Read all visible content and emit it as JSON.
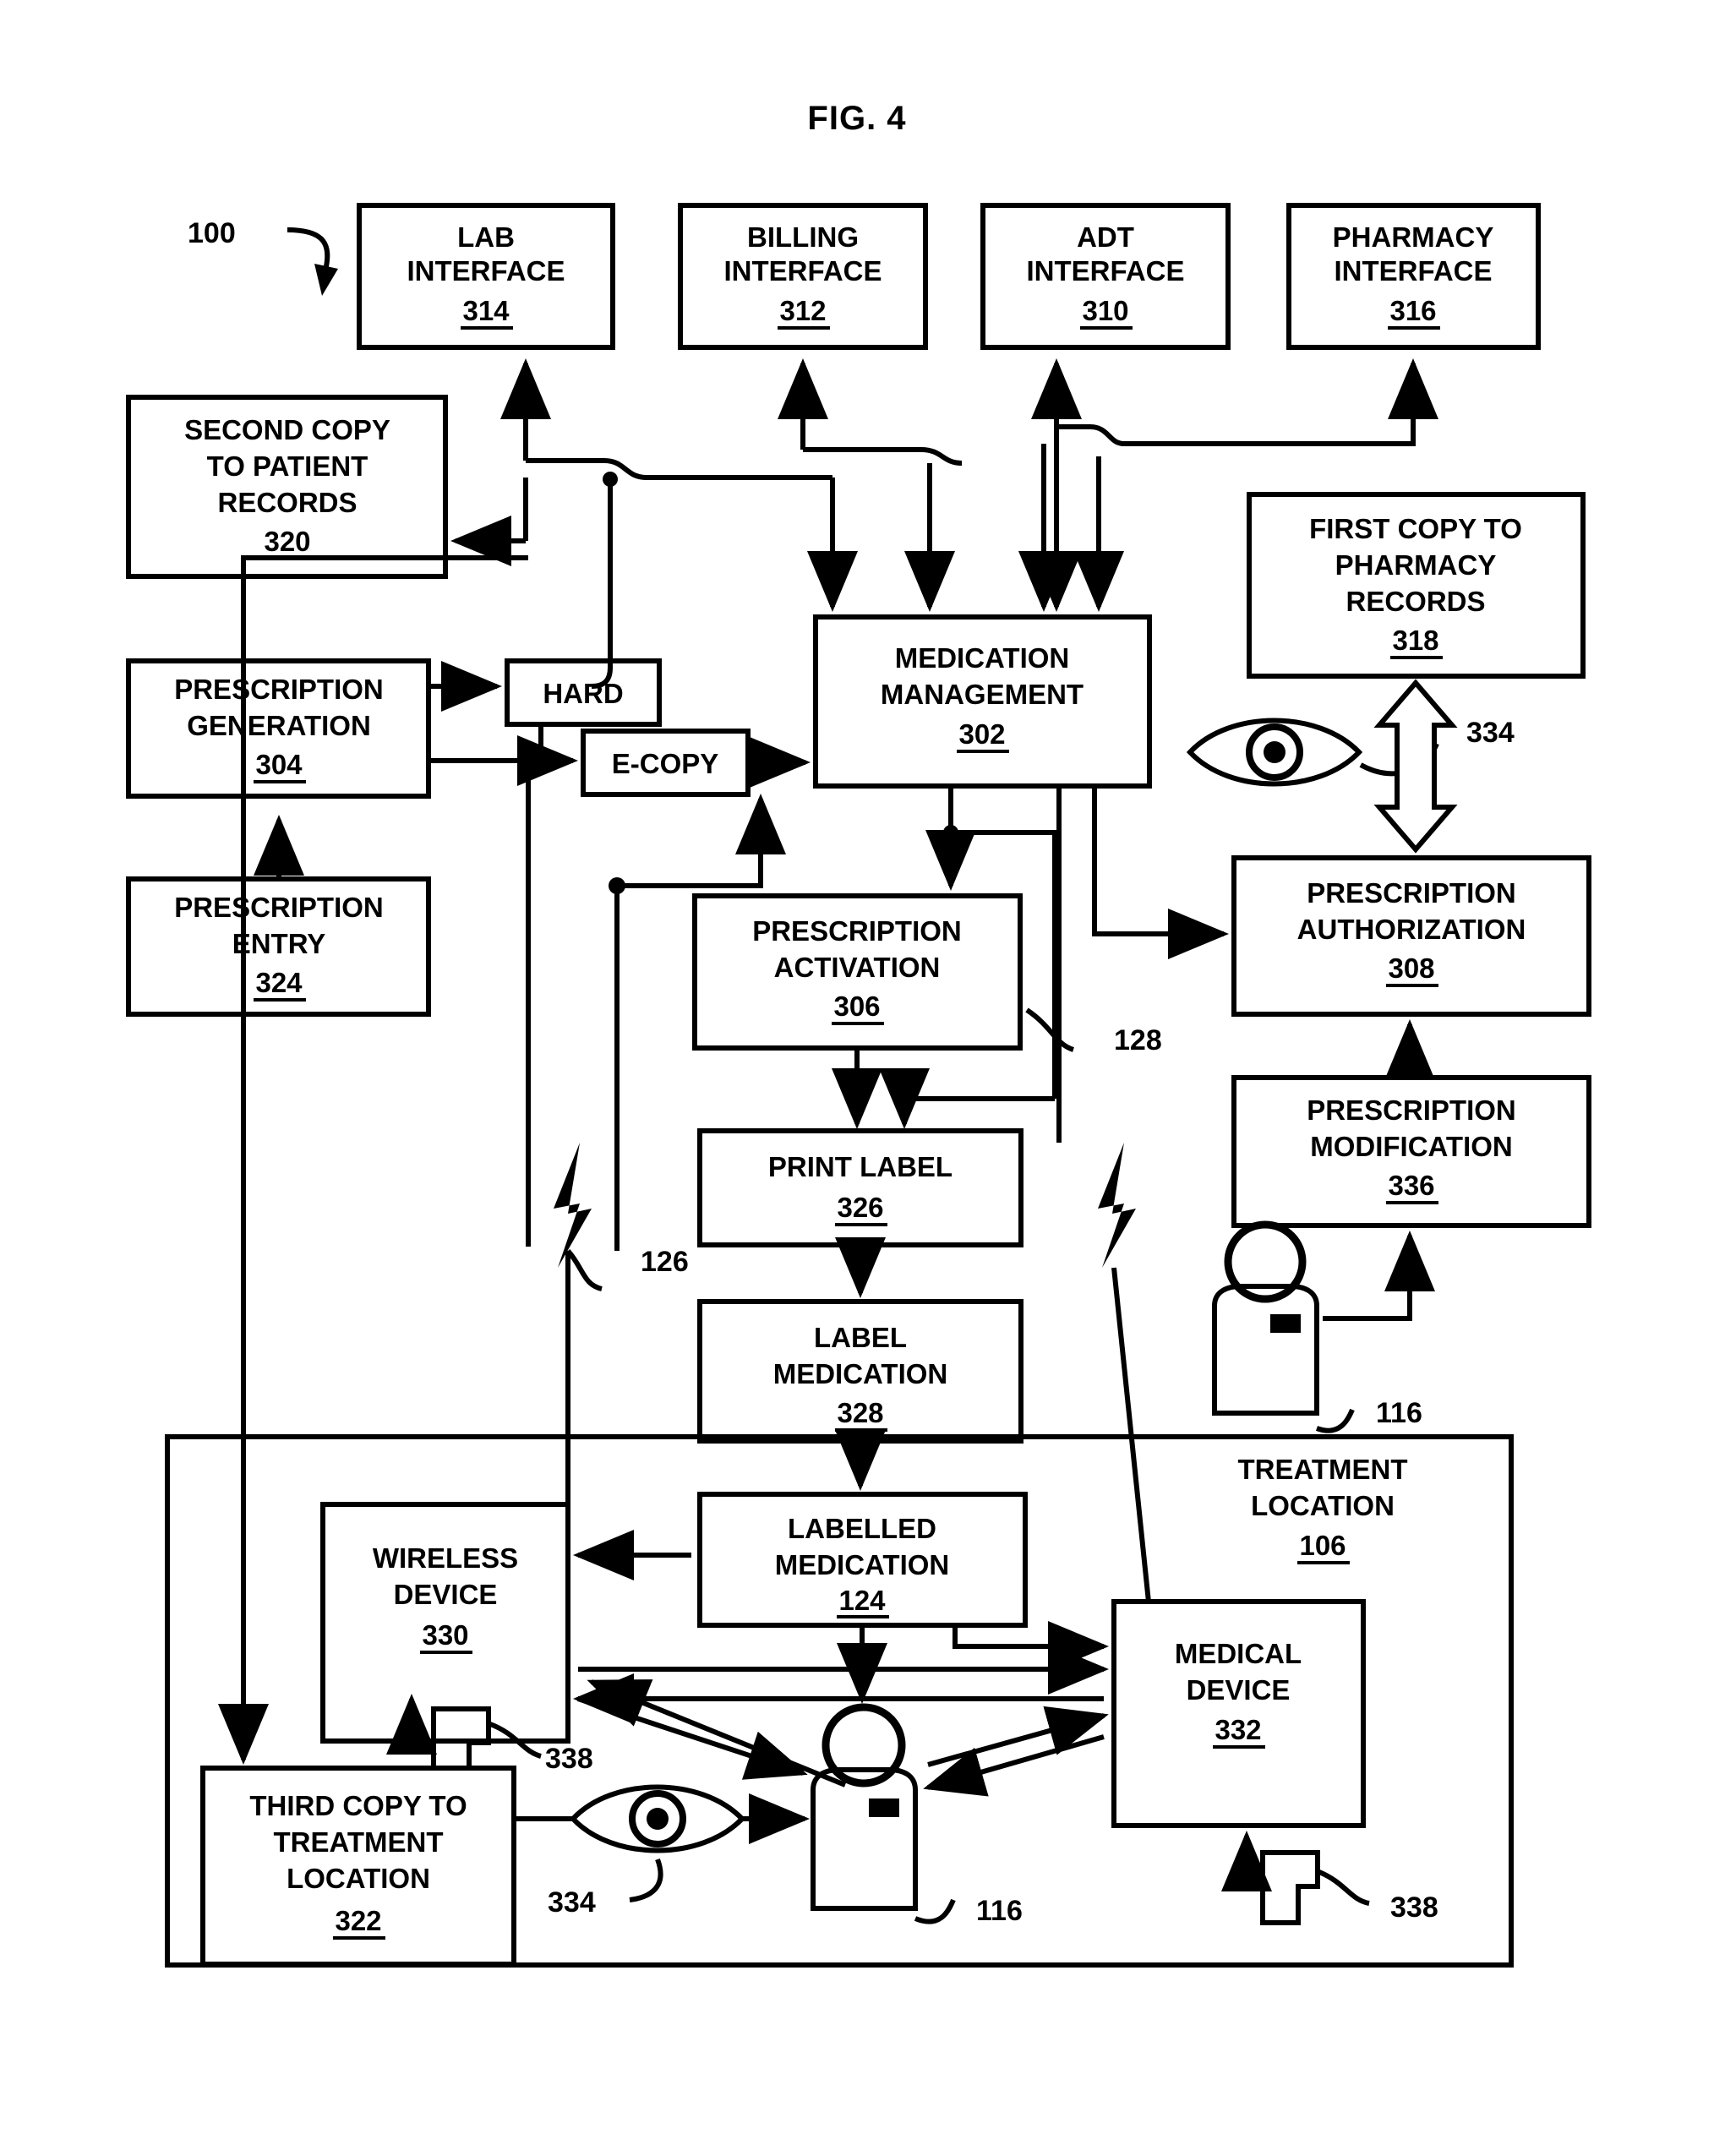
{
  "figure": {
    "title": "FIG. 4",
    "system_ref": "100"
  },
  "boxes": {
    "lab_interface": {
      "line1": "LAB",
      "line2": "INTERFACE",
      "ref": "314"
    },
    "billing_interface": {
      "line1": "BILLING",
      "line2": "INTERFACE",
      "ref": "312"
    },
    "adt_interface": {
      "line1": "ADT",
      "line2": "INTERFACE",
      "ref": "310"
    },
    "pharmacy_interface": {
      "line1": "PHARMACY",
      "line2": "INTERFACE",
      "ref": "316"
    },
    "second_copy": {
      "line1": "SECOND COPY",
      "line2": "TO PATIENT",
      "line3": "RECORDS",
      "ref": "320"
    },
    "first_copy": {
      "line1": "FIRST COPY TO",
      "line2": "PHARMACY",
      "line3": "RECORDS",
      "ref": "318"
    },
    "prescription_generation": {
      "line1": "PRESCRIPTION",
      "line2": "GENERATION",
      "ref": "304"
    },
    "prescription_entry": {
      "line1": "PRESCRIPTION",
      "line2": "ENTRY",
      "ref": "324"
    },
    "hard": {
      "line1": "HARD"
    },
    "ecopy": {
      "line1": "E-COPY"
    },
    "medication_management": {
      "line1": "MEDICATION",
      "line2": "MANAGEMENT",
      "ref": "302"
    },
    "prescription_activation": {
      "line1": "PRESCRIPTION",
      "line2": "ACTIVATION",
      "ref": "306"
    },
    "prescription_authorization": {
      "line1": "PRESCRIPTION",
      "line2": "AUTHORIZATION",
      "ref": "308"
    },
    "prescription_modification": {
      "line1": "PRESCRIPTION",
      "line2": "MODIFICATION",
      "ref": "336"
    },
    "print_label": {
      "line1": "PRINT LABEL",
      "ref": "326"
    },
    "label_medication": {
      "line1": "LABEL",
      "line2": "MEDICATION",
      "ref": "328"
    },
    "labelled_medication": {
      "line1": "LABELLED",
      "line2": "MEDICATION",
      "ref": "124"
    },
    "wireless_device": {
      "line1": "WIRELESS",
      "line2": "DEVICE",
      "ref": "330"
    },
    "medical_device": {
      "line1": "MEDICAL",
      "line2": "DEVICE",
      "ref": "332"
    },
    "third_copy": {
      "line1": "THIRD COPY TO",
      "line2": "TREATMENT",
      "line3": "LOCATION",
      "ref": "322"
    },
    "treatment_location": {
      "line1": "TREATMENT",
      "line2": "LOCATION",
      "ref": "106"
    }
  },
  "callouts": {
    "system": "100",
    "bolt_left": "126",
    "bolt_right": "128",
    "eye_upper": "334",
    "eye_lower": "334",
    "patient_upper": "116",
    "patient_lower": "116",
    "tag_upper": "338",
    "tag_lower": "338"
  }
}
